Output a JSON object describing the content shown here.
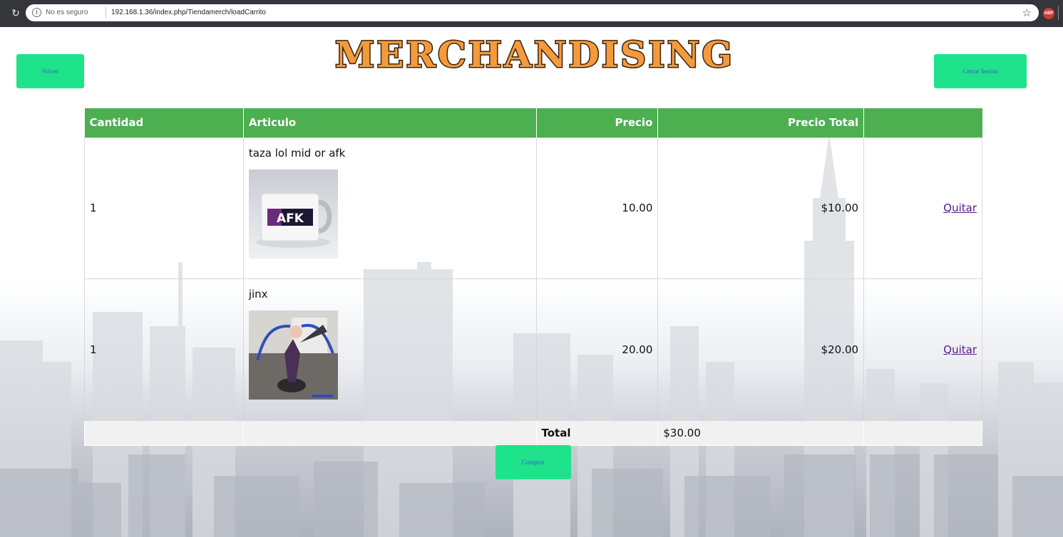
{
  "browser": {
    "security_label": "No es seguro",
    "url": "192.168.1.36/index.php/Tiendamerch/loadCarrito",
    "adblock_label": "ABP"
  },
  "header": {
    "logo_text": "MERCHANDISING",
    "back_label": "Volver",
    "logout_label": "Cerrar Sesion"
  },
  "cart": {
    "columns": {
      "quantity": "Cantidad",
      "article": "Articulo",
      "price": "Precio",
      "total_price": "Precio Total"
    },
    "items": [
      {
        "quantity": "1",
        "name": "taza lol mid or afk",
        "price": "10.00",
        "total": "$10.00",
        "remove_label": "Quitar",
        "image_text": "AFK"
      },
      {
        "quantity": "1",
        "name": "jinx",
        "price": "20.00",
        "total": "$20.00",
        "remove_label": "Quitar"
      }
    ],
    "total_label": "Total",
    "total_value": "$30.00",
    "buy_label": "Comprar"
  },
  "colors": {
    "header_green": "#4caf50",
    "button_green": "#1ee38a",
    "button_text": "#4a52d6",
    "logo_orange": "#f59a3c"
  }
}
